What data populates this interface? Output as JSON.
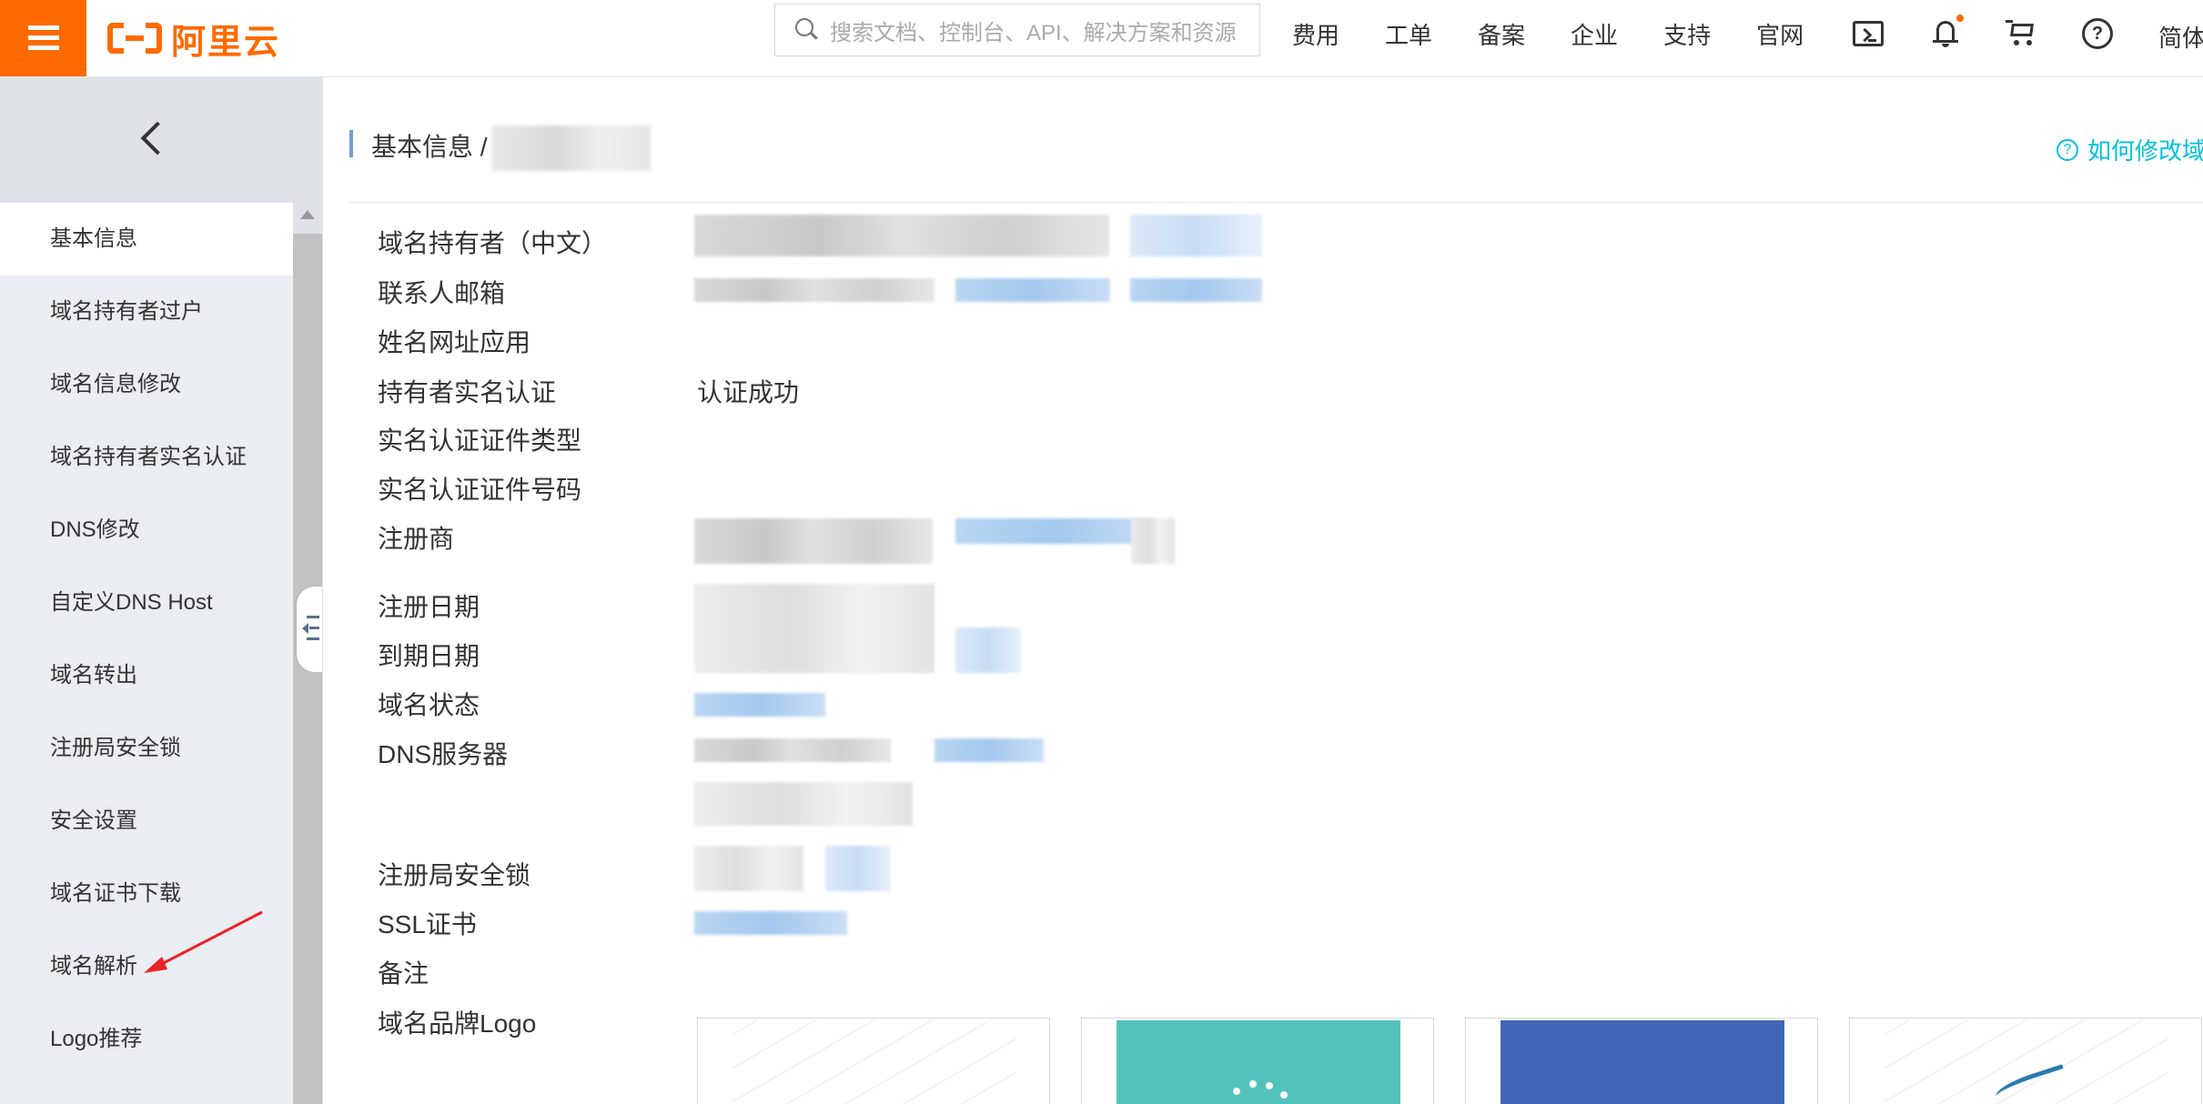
{
  "topbar": {
    "brand": "阿里云",
    "search_placeholder": "搜索文档、控制台、API、解决方案和资源",
    "nav": [
      "费用",
      "工单",
      "备案",
      "企业",
      "支持",
      "官网"
    ],
    "lang": "简体"
  },
  "sidebar": {
    "items": [
      {
        "label": "基本信息",
        "active": true
      },
      {
        "label": "域名持有者过户"
      },
      {
        "label": "域名信息修改"
      },
      {
        "label": "域名持有者实名认证"
      },
      {
        "label": "DNS修改"
      },
      {
        "label": "自定义DNS Host"
      },
      {
        "label": "域名转出"
      },
      {
        "label": "注册局安全锁"
      },
      {
        "label": "安全设置"
      },
      {
        "label": "域名证书下载"
      },
      {
        "label": "域名解析"
      },
      {
        "label": "Logo推荐"
      }
    ]
  },
  "main": {
    "breadcrumb": "基本信息 /",
    "help_link": "如何修改域",
    "fields": {
      "holder_cn": "域名持有者（中文）",
      "contact_email": "联系人邮箱",
      "name_url_app": "姓名网址应用",
      "realname_auth": "持有者实名认证",
      "realname_auth_value": "认证成功",
      "cert_type": "实名认证证件类型",
      "cert_number": "实名认证证件号码",
      "registrar": "注册商",
      "reg_date": "注册日期",
      "exp_date": "到期日期",
      "domain_status": "域名状态",
      "dns_servers": "DNS服务器",
      "registry_lock": "注册局安全锁",
      "ssl_cert": "SSL证书",
      "remark": "备注",
      "brand_logo": "域名品牌Logo"
    }
  },
  "colors": {
    "brand_orange": "#ff6a00",
    "link_cyan": "#00c1de",
    "logo_teal": "#52c3bb",
    "logo_blue": "#4166b5"
  }
}
